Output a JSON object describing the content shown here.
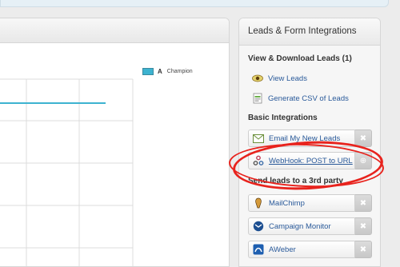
{
  "panel": {
    "title": "Leads & Form Integrations",
    "view_section": {
      "title": "View & Download Leads (1)",
      "links": [
        {
          "label": "View Leads",
          "icon": "eye-icon"
        },
        {
          "label": "Generate CSV of Leads",
          "icon": "csv-document-icon"
        }
      ]
    },
    "basic_section": {
      "title": "Basic Integrations",
      "items": [
        {
          "label": "Email My New Leads",
          "icon": "email-icon",
          "action": "remove-x-icon"
        },
        {
          "label": "WebHook: POST to URL",
          "icon": "webhook-icon",
          "action": "add-plus-icon"
        }
      ]
    },
    "third_party_section": {
      "title": "Send leads to a 3rd party",
      "items": [
        {
          "label": "MailChimp",
          "icon": "mailchimp-icon",
          "action": "remove-x-icon"
        },
        {
          "label": "Campaign Monitor",
          "icon": "campaign-monitor-icon",
          "action": "remove-x-icon"
        },
        {
          "label": "AWeber",
          "icon": "aweber-icon",
          "action": "remove-x-icon"
        }
      ]
    }
  },
  "chart": {
    "legend_letter": "A",
    "legend_label": "Champion",
    "series_color": "#3db3d0"
  },
  "annotation": {
    "highlight_color": "#e8231d"
  }
}
